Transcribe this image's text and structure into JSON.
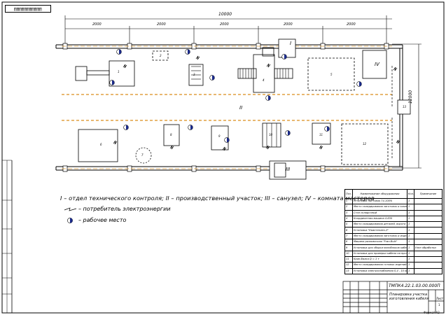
{
  "corner_stamp": "ШШШШШШШШШШШ",
  "dimensions": {
    "total": "10000",
    "spans": [
      "2000",
      "2000",
      "2000",
      "2000",
      "2000"
    ],
    "side": "12000"
  },
  "zone_labels": {
    "I": "I",
    "II": "II",
    "III": "III",
    "IV": "IV"
  },
  "legend": {
    "title": "I – отдел технического контроля; II – производственный участок; III – санузел; IV – комната мастеров",
    "power_consumer": "– потребитель электроэнергии",
    "workplace": "– рабочее место"
  },
  "equipment_table": {
    "headers": [
      "Поз. обозн.",
      "Наименование оборудования",
      "Кол.",
      "Примечание"
    ],
    "rows": [
      [
        "1",
        "Установка листовая 74-100%",
        "1",
        ""
      ],
      [
        "2",
        "Место складирования заготовок и комплектующих",
        "1",
        ""
      ],
      [
        "3",
        "Стол складочный",
        "1",
        ""
      ],
      [
        "4",
        "Координатная машина 4-630",
        "1",
        ""
      ],
      [
        "5",
        "Место складирования деталей, ворота",
        "1",
        ""
      ],
      [
        "6",
        "Установка \"Квантеллео-2\"",
        "1",
        ""
      ],
      [
        "7",
        "Место складирования заготовок и изделий",
        "1",
        ""
      ],
      [
        "8",
        "Машина разливочная \"Fran-Bulk\"",
        "1",
        ""
      ],
      [
        "9",
        "Установка для сборки моноблоков кабеля",
        "1",
        "Узел обработки"
      ],
      [
        "10",
        "Установка для проверки кабеля на прочность",
        "1",
        ""
      ],
      [
        "11",
        "Кран-балка Q = 1 т",
        "1",
        ""
      ],
      [
        "12",
        "Место складирования готовых изделий",
        "1",
        ""
      ],
      [
        "13",
        "Установка электроснабжения 0,4 - 10 кВ",
        "1",
        ""
      ]
    ]
  },
  "title_block": {
    "doc_code": "ТМПК4.22.1.03.00.000П",
    "name": "Планировка участка изготовления кабеля",
    "sheet": "Лист",
    "sheet_num": "1",
    "bottom": "Формат A2"
  },
  "positions": [
    "1",
    "2",
    "3",
    "4",
    "5",
    "6",
    "7",
    "8",
    "9",
    "10",
    "11",
    "12",
    "13"
  ]
}
